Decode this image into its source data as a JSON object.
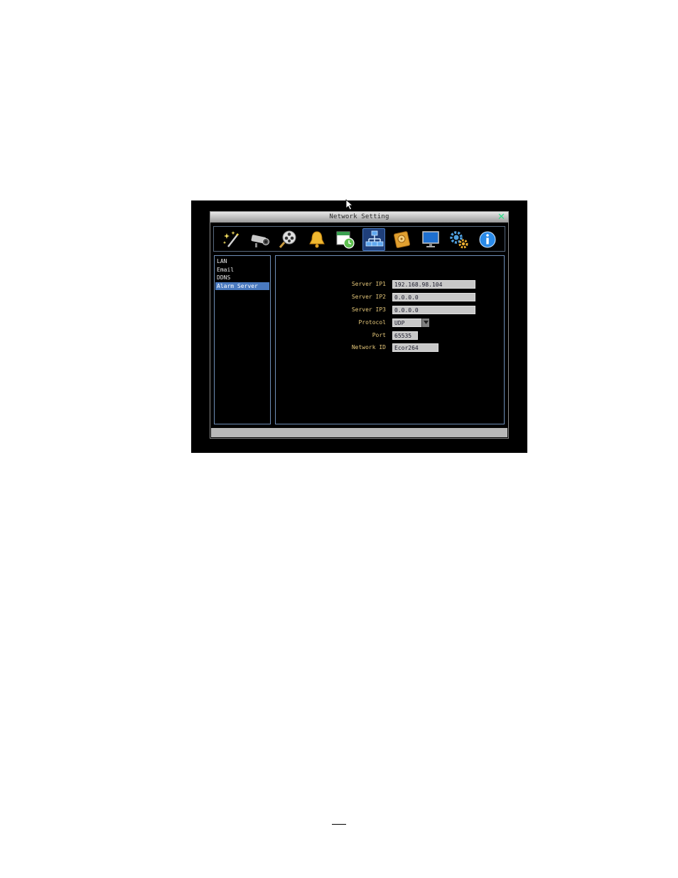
{
  "window": {
    "title": "Network Setting",
    "close_icon": "close-icon",
    "accent_color": "#2ee08a"
  },
  "toolbar": {
    "items": [
      {
        "icon": "wizard-wand-icon"
      },
      {
        "icon": "camera-icon"
      },
      {
        "icon": "search-playback-icon"
      },
      {
        "icon": "alarm-bell-icon"
      },
      {
        "icon": "schedule-clock-icon"
      },
      {
        "icon": "network-icon",
        "active": true
      },
      {
        "icon": "hard-disk-icon"
      },
      {
        "icon": "monitor-icon"
      },
      {
        "icon": "system-gears-icon"
      },
      {
        "icon": "info-icon"
      }
    ]
  },
  "sidebar": {
    "items": [
      {
        "label": "LAN"
      },
      {
        "label": "Email"
      },
      {
        "label": "DDNS"
      },
      {
        "label": "Alarm Server",
        "selected": true
      }
    ]
  },
  "form": {
    "server_ip1": {
      "label": "Server IP1",
      "value": "192.168.98.104"
    },
    "server_ip2": {
      "label": "Server IP2",
      "value": "0.0.0.0"
    },
    "server_ip3": {
      "label": "Server IP3",
      "value": "0.0.0.0"
    },
    "protocol": {
      "label": "Protocol",
      "value": "UDP"
    },
    "port": {
      "label": "Port",
      "value": "65535"
    },
    "network_id": {
      "label": "Network ID",
      "value": "Ecor264"
    }
  }
}
